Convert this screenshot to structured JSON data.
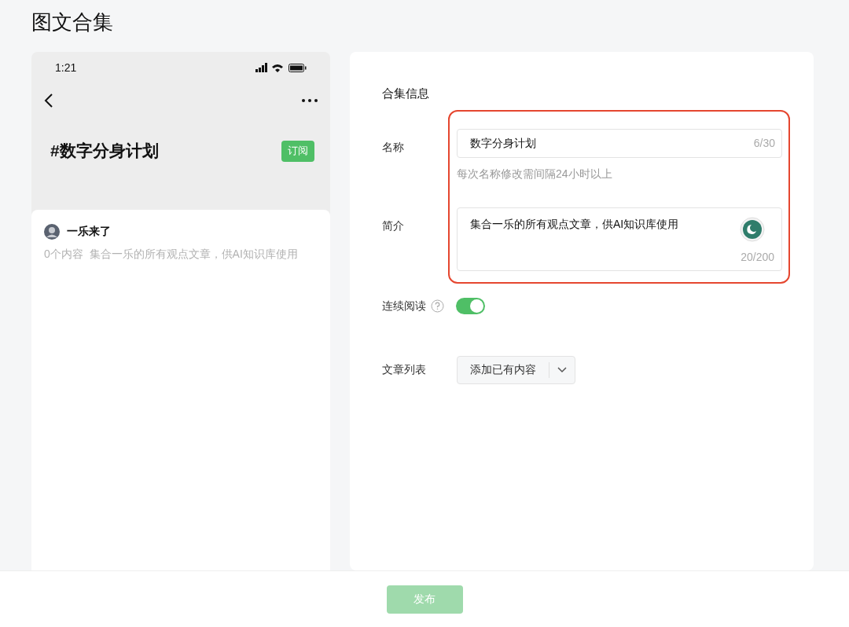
{
  "page_title": "图文合集",
  "preview": {
    "time": "1:21",
    "collection_title": "#数字分身计划",
    "subscribe_button": "订阅",
    "author": "一乐来了",
    "summary": "0个内容  集合一乐的所有观点文章，供AI知识库使用"
  },
  "form": {
    "section_title": "合集信息",
    "name": {
      "label": "名称",
      "value": "数字分身计划",
      "counter": "6/30",
      "hint": "每次名称修改需间隔24小时以上"
    },
    "intro": {
      "label": "简介",
      "value": "集合一乐的所有观点文章，供AI知识库使用",
      "counter": "20/200"
    },
    "continuous_reading": {
      "label": "连续阅读",
      "on": true
    },
    "article_list": {
      "label": "文章列表",
      "button": "添加已有内容"
    }
  },
  "publish": {
    "label": "发布",
    "disabled": true
  }
}
